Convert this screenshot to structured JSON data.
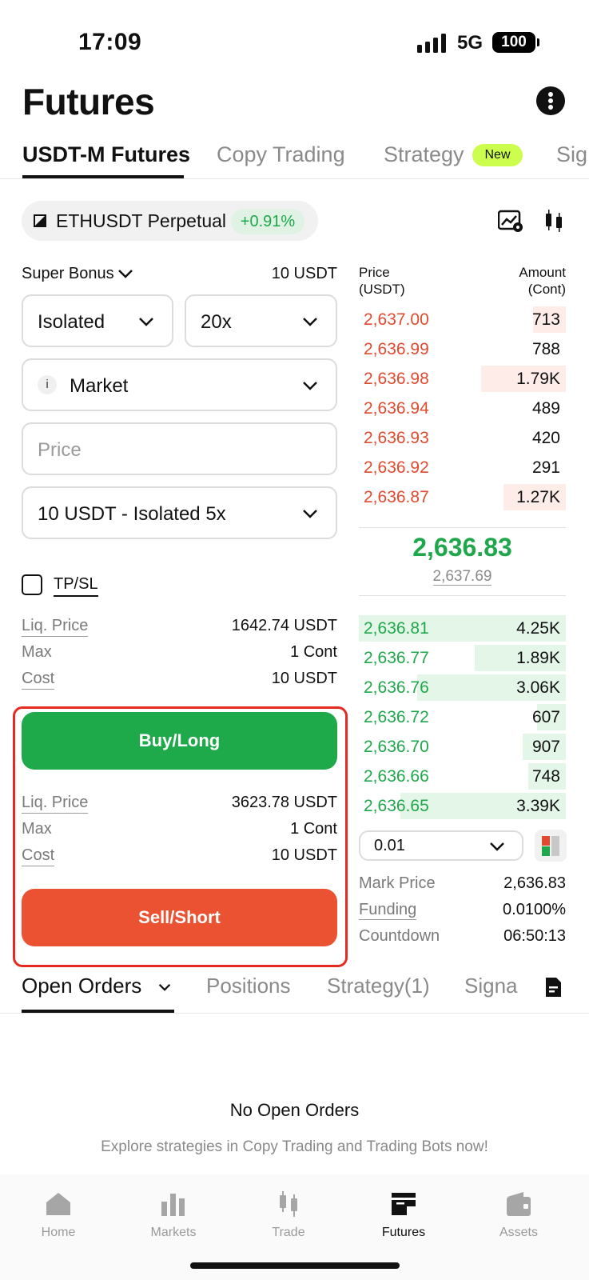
{
  "status_bar": {
    "time": "17:09",
    "network": "5G",
    "battery": "100"
  },
  "header": {
    "title": "Futures",
    "more_icon": "more-vertical-icon"
  },
  "tabs": [
    {
      "label": "USDT-M Futures",
      "active": true
    },
    {
      "label": "Copy Trading"
    },
    {
      "label": "Strategy",
      "badge": "New"
    },
    {
      "label": "Sig"
    }
  ],
  "pair": {
    "name": "ETHUSDT Perpetual",
    "change": "+0.91%",
    "change_color": "#1fa84b"
  },
  "form": {
    "bonus_label": "Super Bonus",
    "bonus_value": "10 USDT",
    "margin_mode": "Isolated",
    "leverage": "20x",
    "order_info_icon": "i",
    "order_type": "Market",
    "price_placeholder": "Price",
    "amount": "10 USDT - Isolated 5x",
    "tpsl_label": "TP/SL",
    "long_info": [
      {
        "k": "Liq. Price",
        "v": "1642.74 USDT"
      },
      {
        "k": "Max",
        "v": "1 Cont"
      },
      {
        "k": "Cost",
        "v": "10 USDT"
      }
    ],
    "buy_label": "Buy/Long",
    "short_info": [
      {
        "k": "Liq. Price",
        "v": "3623.78 USDT"
      },
      {
        "k": "Max",
        "v": "1 Cont"
      },
      {
        "k": "Cost",
        "v": "10 USDT"
      }
    ],
    "sell_label": "Sell/Short"
  },
  "orderbook": {
    "price_header": "Price",
    "price_unit": "(USDT)",
    "amount_header": "Amount",
    "amount_unit": "(Cont)",
    "asks": [
      {
        "price": "2,637.00",
        "amount": "713"
      },
      {
        "price": "2,636.99",
        "amount": "788"
      },
      {
        "price": "2,636.98",
        "amount": "1.79K"
      },
      {
        "price": "2,636.94",
        "amount": "489"
      },
      {
        "price": "2,636.93",
        "amount": "420"
      },
      {
        "price": "2,636.92",
        "amount": "291"
      },
      {
        "price": "2,636.87",
        "amount": "1.27K"
      }
    ],
    "last_price": "2,636.83",
    "mark_price_under": "2,637.69",
    "bids": [
      {
        "price": "2,636.81",
        "amount": "4.25K"
      },
      {
        "price": "2,636.77",
        "amount": "1.89K"
      },
      {
        "price": "2,636.76",
        "amount": "3.06K"
      },
      {
        "price": "2,636.72",
        "amount": "607"
      },
      {
        "price": "2,636.70",
        "amount": "907"
      },
      {
        "price": "2,636.66",
        "amount": "748"
      },
      {
        "price": "2,636.65",
        "amount": "3.39K"
      }
    ],
    "step": "0.01",
    "mark_label": "Mark Price",
    "mark_value": "2,636.83",
    "funding_label": "Funding",
    "funding_value": "0.0100%",
    "countdown_label": "Countdown",
    "countdown_value": "06:50:13",
    "ask_color": "#e04a2e",
    "bid_color": "#1fa84b"
  },
  "bottom_tabs": [
    {
      "label": "Open Orders",
      "active": true
    },
    {
      "label": "Positions"
    },
    {
      "label": "Strategy(1)"
    },
    {
      "label": "Signa"
    }
  ],
  "empty": {
    "title": "No Open Orders",
    "subtitle": "Explore strategies in Copy Trading and Trading Bots now!"
  },
  "nav": [
    {
      "label": "Home",
      "icon": "home-icon"
    },
    {
      "label": "Markets",
      "icon": "markets-icon"
    },
    {
      "label": "Trade",
      "icon": "trade-icon"
    },
    {
      "label": "Futures",
      "icon": "futures-icon",
      "active": true
    },
    {
      "label": "Assets",
      "icon": "wallet-icon"
    }
  ]
}
